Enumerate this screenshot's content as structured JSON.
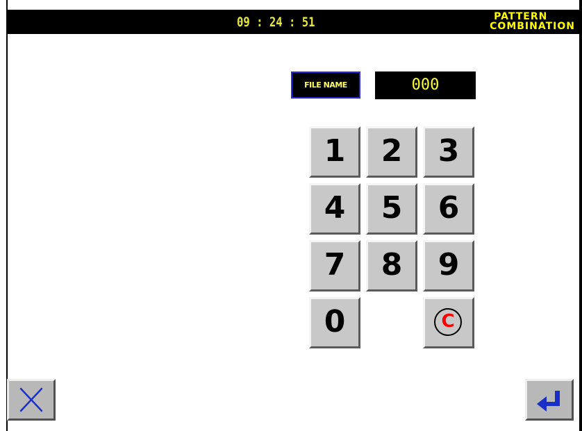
{
  "header": {
    "clock": "09 : 24 : 51",
    "title_line1": "PATTERN",
    "title_line2": "COMBINATION"
  },
  "file": {
    "label": "FILE NAME",
    "value": "000"
  },
  "keypad": {
    "keys": [
      "1",
      "2",
      "3",
      "4",
      "5",
      "6",
      "7",
      "8",
      "9",
      "0"
    ],
    "clear_label": "C"
  },
  "footer": {
    "cancel_icon": "close-icon",
    "enter_icon": "enter-icon"
  },
  "colors": {
    "header_text": "#ffff00",
    "clear_text": "#ff0000",
    "icon_blue": "#1b2fc8"
  }
}
